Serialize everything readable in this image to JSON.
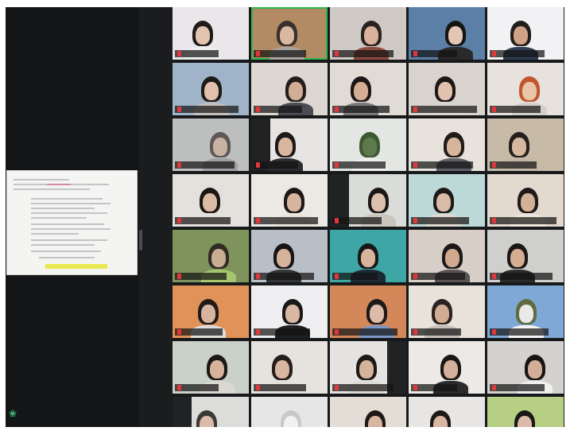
{
  "colors": {
    "app_bg": "#17191b",
    "active_speaker": "#2fb84f",
    "mute": "#e2363a"
  },
  "share_panel": {
    "icon": "security-shield-icon"
  },
  "tiles": [
    {
      "bg": "#e9e7ea",
      "face": "#e2c4b0",
      "hair": "#1f1b1a",
      "shirt": "#efefef",
      "dark": false
    },
    {
      "bg": "#b28a63",
      "face": "#d9b9a2",
      "hair": "#3a302b",
      "shirt": "#a8a39e",
      "active": true
    },
    {
      "bg": "#cfc9c6",
      "face": "#d8b29c",
      "hair": "#2a2220",
      "shirt": "#8d4a3e"
    },
    {
      "bg": "#5c7fa8",
      "face": "#e4c6b4",
      "hair": "#161413",
      "shirt": "#2a2a2c"
    },
    {
      "bg": "#f2f2f4",
      "face": "#cfa287",
      "hair": "#221d1b",
      "shirt": "#2f3e55"
    },
    {
      "bg": "#9fb4c8",
      "face": "#e0c0ac",
      "hair": "#1e1a18",
      "shirt": "#c4c0bd"
    },
    {
      "bg": "#dcd7d1",
      "face": "#d2ad96",
      "hair": "#231e1c",
      "shirt": "#4b4c52"
    },
    {
      "bg": "#e1dbd6",
      "face": "#d4ad95",
      "hair": "#1b1716",
      "shirt": "#7a7a7c"
    },
    {
      "bg": "#d8d3cc",
      "face": "#e1c2ae",
      "hair": "#1c1817",
      "shirt": "#d8d5d1"
    },
    {
      "bg": "#e7e2dd",
      "face": "#e8c6a8",
      "hair": "#c2552d",
      "shirt": "#d4d0cc"
    },
    {
      "bg": "#bdbfbf",
      "face": "#c8b3a3",
      "hair": "#5d5855",
      "shirt": "#9d9fa0"
    },
    {
      "bg": "#e6e5e3",
      "face": "#d9b79f",
      "hair": "#1d1918",
      "shirt": "#2c2d31",
      "dark": true
    },
    {
      "bg": "#e3e6e3",
      "face": "#5e7a4d",
      "hair": "#3c5a32",
      "shirt": "#f0f0ef"
    },
    {
      "bg": "#e7e3dc",
      "face": "#d8b59a",
      "hair": "#1f1b19",
      "shirt": "#5d5f66"
    },
    {
      "bg": "#c7bba8",
      "face": "#d6b8a0",
      "hair": "#261f1c",
      "shirt": "#c2b7a7"
    },
    {
      "bg": "#e4e1dd",
      "face": "#dcbba4",
      "hair": "#1a1716",
      "shirt": "#e4e0dc"
    },
    {
      "bg": "#ece9e4",
      "face": "#d6b49e",
      "hair": "#1c1817",
      "shirt": "#e8e2d8"
    },
    {
      "bg": "#d9dcd8",
      "face": "#dcc0ad",
      "hair": "#1b1717",
      "shirt": "#c9c5bf",
      "dark": true
    },
    {
      "bg": "#bcd9d8",
      "face": "#d9bba6",
      "hair": "#1c1918",
      "shirt": "#e0d9cf"
    },
    {
      "bg": "#e3d9cf",
      "face": "#d3b097",
      "hair": "#1e1a19",
      "shirt": "#efe6db"
    },
    {
      "bg": "#7f935c",
      "face": "#c9ad92",
      "hair": "#2f2b24",
      "shirt": "#a5c66e"
    },
    {
      "bg": "#b9bfc7",
      "face": "#d4b29b",
      "hair": "#171515",
      "shirt": "#333537"
    },
    {
      "bg": "#3ea7a5",
      "face": "#d7b59c",
      "hair": "#191717",
      "shirt": "#1d2a33"
    },
    {
      "bg": "#d7cfc7",
      "face": "#d1a98f",
      "hair": "#1d1918",
      "shirt": "#5a5355"
    },
    {
      "bg": "#cfd0ce",
      "face": "#d4ad93",
      "hair": "#1a1716",
      "shirt": "#2c2b2c"
    },
    {
      "bg": "#e19259",
      "face": "#d8b4a0",
      "hair": "#1f1b1a",
      "shirt": "#dfdcd9"
    },
    {
      "bg": "#efeff1",
      "face": "#d9b7a2",
      "hair": "#1a1717",
      "shirt": "#1f1f22"
    },
    {
      "bg": "#d4885a",
      "face": "#ddbba8",
      "hair": "#1c1918",
      "shirt": "#7d97c5"
    },
    {
      "bg": "#e8e2da",
      "face": "#d3ac95",
      "hair": "#2a2220",
      "shirt": "#c5c0ba"
    },
    {
      "bg": "#7fa8d5",
      "face": "#e9e9ea",
      "hair": "#5f6c3f",
      "shirt": "#f4f4f4"
    },
    {
      "bg": "#c9d1c9",
      "face": "#d7b39c",
      "hair": "#1d1918",
      "shirt": "#dbd7d1"
    },
    {
      "bg": "#e6e2dd",
      "face": "#d9b6a0",
      "hair": "#241f1d",
      "shirt": "#e4e0da"
    },
    {
      "bg": "#e4e3e1",
      "face": "#d7b39c",
      "hair": "#1c1917",
      "shirt": "#dedad5",
      "dark": true
    },
    {
      "bg": "#ece9e6",
      "face": "#d5b19b",
      "hair": "#1a1716",
      "shirt": "#2b2b2e"
    },
    {
      "bg": "#d4d2cf",
      "face": "#d3ae98",
      "hair": "#181615",
      "shirt": "#efefef"
    },
    {
      "bg": "#dcdcda",
      "face": "#dcbca8",
      "hair": "#3c3a38",
      "shirt": "#cfcdcb",
      "dark": true
    },
    {
      "bg": "#e6e6e6",
      "face": "#f1f1f1",
      "hair": "#c7c9cb",
      "shirt": "#f2f2f2"
    },
    {
      "bg": "#e3ddd6",
      "face": "#d8b6a1",
      "hair": "#1d1918",
      "shirt": "#3a3a3d"
    },
    {
      "bg": "#e8e6e4",
      "face": "#d8b7a2",
      "hair": "#1c1917",
      "shirt": "#2d2f38"
    },
    {
      "bg": "#b7cf84",
      "face": "#dcbca8",
      "hair": "#1a1716",
      "shirt": "#5b6e39"
    }
  ]
}
